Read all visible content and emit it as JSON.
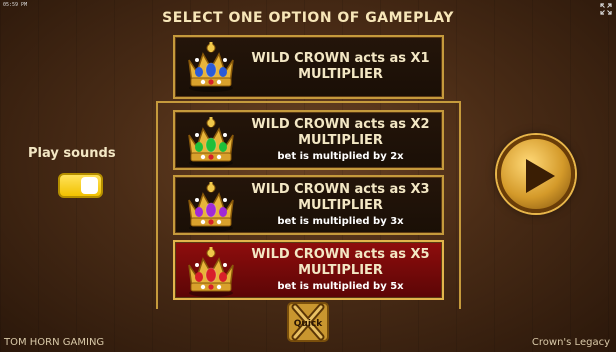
{
  "status": {
    "clock": "05:59 PM"
  },
  "header": {
    "title": "SELECT ONE OPTION OF GAMEPLAY"
  },
  "options": [
    {
      "line1": "WILD CROWN acts as X1",
      "line2": "MULTIPLIER",
      "line3": "",
      "jewel_color": "#2a5bd8",
      "selected": false
    },
    {
      "line1": "WILD CROWN acts as X2",
      "line2": "MULTIPLIER",
      "line3": "bet is multiplied by 2x",
      "jewel_color": "#1fbf3a",
      "selected": false
    },
    {
      "line1": "WILD CROWN acts as X3",
      "line2": "MULTIPLIER",
      "line3": "bet is multiplied by 3x",
      "jewel_color": "#a12ad6",
      "selected": false
    },
    {
      "line1": "WILD CROWN acts as X5",
      "line2": "MULTIPLIER",
      "line3": "bet is multiplied by 5x",
      "jewel_color": "#d8202a",
      "selected": true
    }
  ],
  "sounds": {
    "label": "Play sounds",
    "enabled": true
  },
  "quick": {
    "label": "Quick"
  },
  "footer": {
    "brand": "TOM HORN GAMING",
    "game": "Crown's Legacy"
  },
  "colors": {
    "gold": "#c59a3c",
    "selected_bg": "#8f0d0d",
    "toggle_on": "#f2c200"
  }
}
